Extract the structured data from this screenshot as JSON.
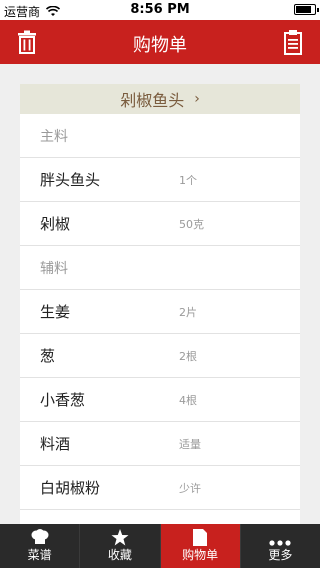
{
  "status": {
    "carrier": "运营商",
    "time": "8:56 PM",
    "battery_level": 0.85
  },
  "nav": {
    "title": "购物单",
    "left_icon": "trash-icon",
    "right_icon": "clipboard-icon"
  },
  "recipe": {
    "title": "剁椒鱼头",
    "chevron": "›"
  },
  "rows": [
    {
      "type": "section",
      "name": "主料",
      "qty": ""
    },
    {
      "type": "item",
      "name": "胖头鱼头",
      "qty": "1个"
    },
    {
      "type": "item",
      "name": "剁椒",
      "qty": "50克"
    },
    {
      "type": "section",
      "name": "辅料",
      "qty": ""
    },
    {
      "type": "item",
      "name": "生姜",
      "qty": "2片"
    },
    {
      "type": "item",
      "name": "葱",
      "qty": "2根"
    },
    {
      "type": "item",
      "name": "小香葱",
      "qty": "4根"
    },
    {
      "type": "item",
      "name": "料酒",
      "qty": "适量"
    },
    {
      "type": "item",
      "name": "白胡椒粉",
      "qty": "少许"
    }
  ],
  "tabs": [
    {
      "label": "菜谱",
      "icon": "chef-hat-icon",
      "active": false
    },
    {
      "label": "收藏",
      "icon": "star-icon",
      "active": false
    },
    {
      "label": "购物单",
      "icon": "document-icon",
      "active": true
    },
    {
      "label": "更多",
      "icon": "more-dots-icon",
      "active": false
    }
  ],
  "colors": {
    "accent": "#c8211e",
    "header_bg": "#e6e6d9",
    "header_text": "#7a5c3e",
    "tabbar": "#2a2a2a"
  }
}
